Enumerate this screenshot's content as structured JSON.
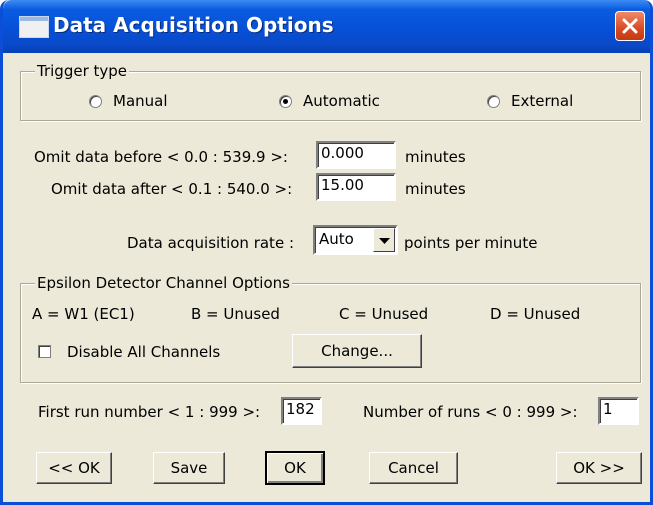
{
  "window": {
    "title": "Data Acquisition Options",
    "icons": {
      "app": "window-icon",
      "close": "close-icon"
    }
  },
  "trigger": {
    "legend": "Trigger type",
    "options": [
      {
        "label": "Manual",
        "selected": false
      },
      {
        "label": "Automatic",
        "selected": true
      },
      {
        "label": "External",
        "selected": false
      }
    ]
  },
  "omit": {
    "before_label": "Omit data before < 0.0 : 539.9 >:",
    "before_value": "0.000",
    "before_unit": "minutes",
    "after_label": "Omit data after < 0.1 : 540.0 >:",
    "after_value": "15.00",
    "after_unit": "minutes"
  },
  "rate": {
    "label": "Data acquisition rate :",
    "value": "Auto",
    "unit": "points per minute"
  },
  "epsilon": {
    "legend": "Epsilon Detector Channel Options",
    "channels": [
      "A = W1 (EC1)",
      "B = Unused",
      "C = Unused",
      "D = Unused"
    ],
    "disable_label": "Disable All Channels",
    "disable_checked": false,
    "change_label": "Change..."
  },
  "runs": {
    "first_label": "First run number < 1 : 999 >:",
    "first_value": "182",
    "count_label": "Number of runs < 0 : 999 >:",
    "count_value": "1"
  },
  "buttons": {
    "prev": "<< OK",
    "save": "Save",
    "ok": "OK",
    "cancel": "Cancel",
    "next": "OK >>"
  }
}
